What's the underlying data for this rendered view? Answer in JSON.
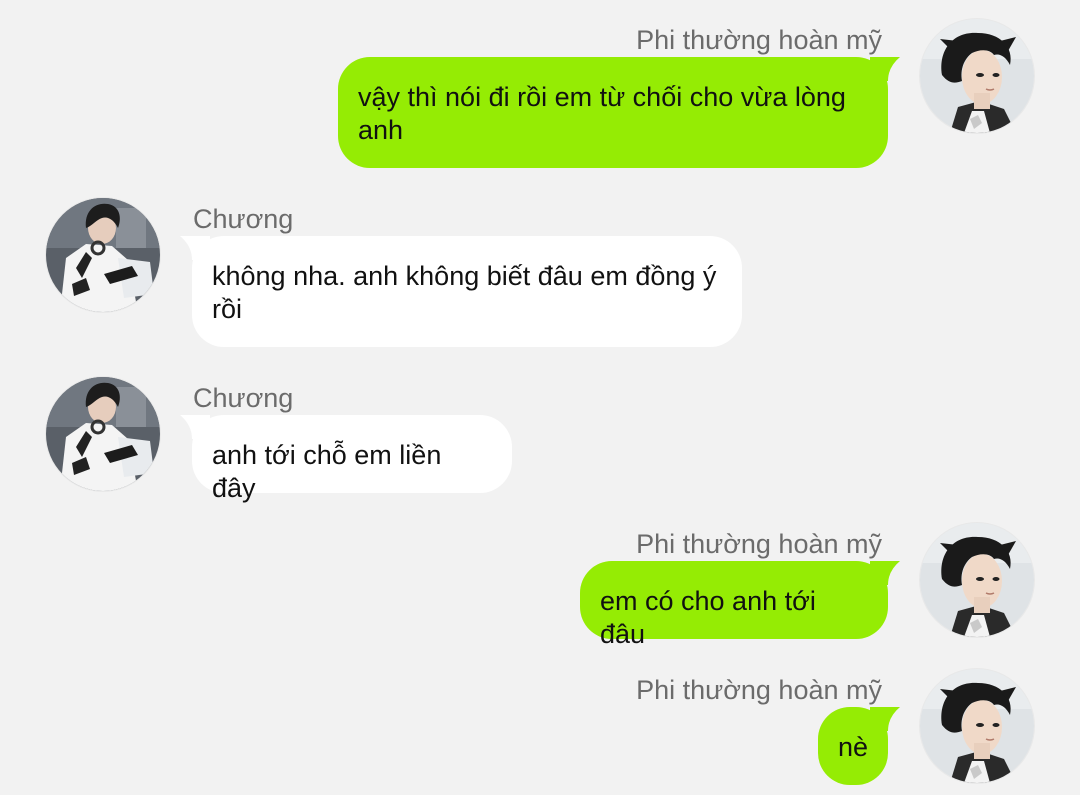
{
  "colors": {
    "background": "#f2f2f2",
    "outgoing_bubble": "#95ec04",
    "incoming_bubble": "#ffffff",
    "sender_name": "#6b6b6b",
    "message_text": "#111111"
  },
  "messages": [
    {
      "direction": "outgoing",
      "sender": "Phi thường hoàn mỹ",
      "text": "vậy thì nói đi rồi em từ chối cho vừa lòng anh",
      "avatar": "avatar-photo-outgoing"
    },
    {
      "direction": "incoming",
      "sender": "Chương",
      "text": "không nha. anh không biết đâu em đồng ý rồi",
      "avatar": "avatar-photo-incoming"
    },
    {
      "direction": "incoming",
      "sender": "Chương",
      "text": "anh tới chỗ em liền đây",
      "avatar": "avatar-photo-incoming"
    },
    {
      "direction": "outgoing",
      "sender": "Phi thường hoàn mỹ",
      "text": "em có cho anh tới đâu",
      "avatar": "avatar-photo-outgoing"
    },
    {
      "direction": "outgoing",
      "sender": "Phi thường hoàn mỹ",
      "text": "nè",
      "avatar": "avatar-photo-outgoing"
    }
  ]
}
